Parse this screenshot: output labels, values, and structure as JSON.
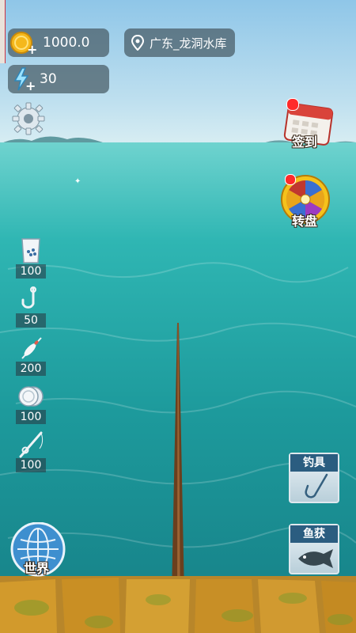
{
  "hud": {
    "coins": "1000.0",
    "energy": "30",
    "location": "广东_龙洞水库"
  },
  "buttons": {
    "checkin_label": "签到",
    "wheel_label": "转盘",
    "world_label": "世界",
    "tackle_label": "钓具",
    "catch_label": "鱼获"
  },
  "inventory": [
    {
      "icon": "bait-bag-icon",
      "count": "100"
    },
    {
      "icon": "hook-icon",
      "count": "50"
    },
    {
      "icon": "float-icon",
      "count": "200"
    },
    {
      "icon": "line-spool-icon",
      "count": "100"
    },
    {
      "icon": "rod-icon",
      "count": "100"
    }
  ],
  "colors": {
    "accent_gold": "#f5b81c",
    "panel_blue": "#2b5d80",
    "sea_dark": "#167f86"
  }
}
